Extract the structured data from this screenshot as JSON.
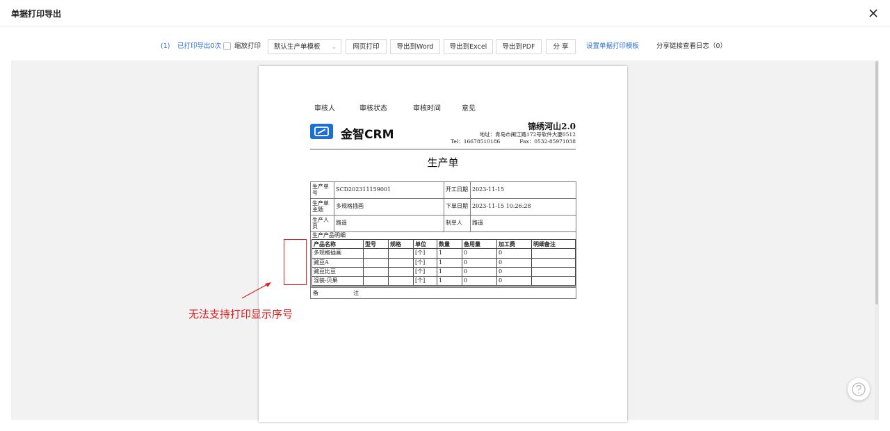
{
  "dialog": {
    "title": "单据打印导出"
  },
  "toolbar": {
    "count": "(1)",
    "printed_link": "已打印导出0次",
    "scale_print": "缩放打印",
    "template_select": "默认生产单模板",
    "btn_web_print": "网页打印",
    "btn_word": "导出到Word",
    "btn_excel": "导出到Excel",
    "btn_pdf": "导出到PDF",
    "btn_share": "分 享",
    "set_template_link": "设置单据打印模板",
    "share_log": "分享链接查看日志（0）"
  },
  "audit_headers": [
    "审核人",
    "审核状态",
    "审核时间",
    "意见"
  ],
  "logo": {
    "brand": "金智CRM",
    "color": "#1f6fd3"
  },
  "company": {
    "name": "锦绣河山2.0",
    "address": "地址：青岛市闽江路172号软件大厦0512",
    "tel": "Tel：16678510186",
    "fax": "Fax：0532-85971038"
  },
  "document": {
    "title": "生产单",
    "order_no_label": "生产单号",
    "order_no": "SCD202311159001",
    "start_date_label": "开工日期",
    "start_date": "2023-11-15",
    "subject_label": "生产单主题",
    "subject": "多规格插画",
    "order_date_label": "下单日期",
    "order_date": "2023-11-15 10:26:28",
    "producer_label": "生产人员",
    "producer": "路遥",
    "maker_label": "制单人",
    "maker": "路遥",
    "detail_title": "生产产品明细",
    "remark_label_a": "备",
    "remark_label_b": "注"
  },
  "items": {
    "headers": [
      "产品名称",
      "型号",
      "规格",
      "单位",
      "数量",
      "备用量",
      "加工费",
      "明细备注"
    ],
    "rows": [
      [
        "多规格插画",
        "",
        "",
        "[个]",
        "1",
        "0",
        "0",
        ""
      ],
      [
        "豌豆A",
        "",
        "",
        "[个]",
        "1",
        "0",
        "0",
        ""
      ],
      [
        "豌豆比豆",
        "",
        "",
        "[个]",
        "1",
        "0",
        "0",
        ""
      ],
      [
        "混装-贝果",
        "",
        "",
        "[个]",
        "1",
        "0",
        "0",
        ""
      ]
    ]
  },
  "annotation": {
    "text": "无法支持打印显示序号",
    "color": "#e02020"
  }
}
